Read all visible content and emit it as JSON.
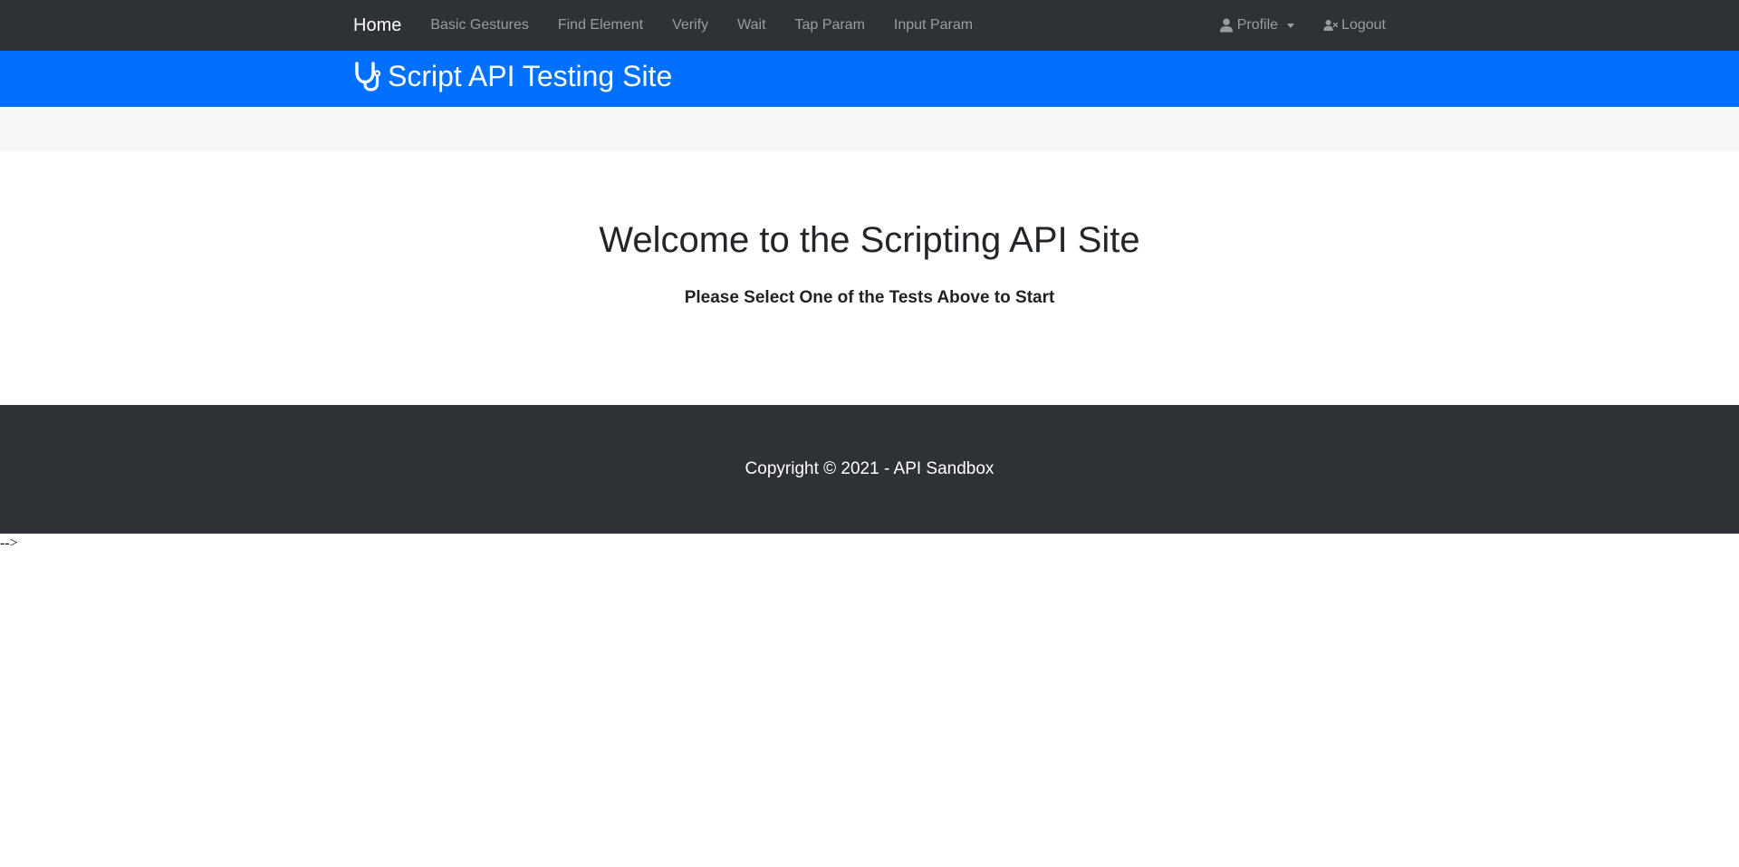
{
  "nav": {
    "brand": "Home",
    "links": [
      "Basic Gestures",
      "Find Element",
      "Verify",
      "Wait",
      "Tap Param",
      "Input Param"
    ],
    "profile": "Profile",
    "logout": "Logout"
  },
  "header": {
    "title": "Script API Testing Site",
    "icon": "stethoscope-icon"
  },
  "main": {
    "heading": "Welcome to the Scripting API Site",
    "subheading": "Please Select One of the Tests Above to Start"
  },
  "footer": {
    "copyright": "Copyright © 2021 - API Sandbox"
  },
  "stray_text": "-->",
  "colors": {
    "navbar_bg": "#2e3237",
    "header_bg": "#0070ff",
    "strip_bg": "#f6f7f9",
    "footer_bg": "#2e3237"
  }
}
